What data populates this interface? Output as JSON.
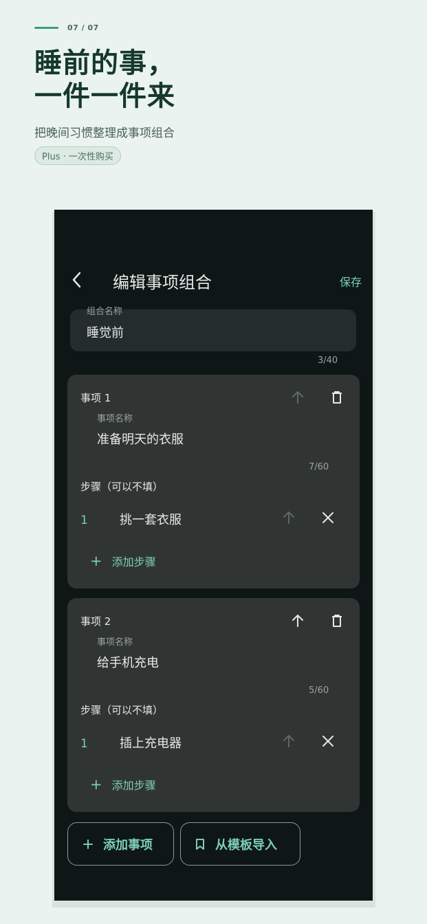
{
  "promo": {
    "page_counter": "07 / 07",
    "headline_line1": "睡前的事，",
    "headline_line2": "一件一件来",
    "subhead": "把晚间习惯整理成事项组合",
    "badge": "Plus · 一次性购买"
  },
  "colors": {
    "accent": "#7ccdb8",
    "screen_bg": "#0e1716",
    "card_bg": "#303534",
    "headline": "#16382d"
  },
  "appbar": {
    "back_icon": "chevron-left-icon",
    "title": "编辑事项组合",
    "save_label": "保存"
  },
  "group_name": {
    "label": "组合名称",
    "value": "睡觉前",
    "counter": "3/40"
  },
  "items": [
    {
      "title": "事项 1",
      "name_label": "事项名称",
      "name_value": "准备明天的衣服",
      "counter": "7/60",
      "steps_label": "步骤（可以不填）",
      "steps": [
        {
          "number": "1",
          "text": "挑一套衣服"
        }
      ],
      "add_step_label": "添加步骤",
      "move_up_enabled": false
    },
    {
      "title": "事项 2",
      "name_label": "事项名称",
      "name_value": "给手机充电",
      "counter": "5/60",
      "steps_label": "步骤（可以不填）",
      "steps": [
        {
          "number": "1",
          "text": "插上充电器"
        }
      ],
      "add_step_label": "添加步骤",
      "move_up_enabled": true
    }
  ],
  "bottom_actions": {
    "add_item_label": "添加事项",
    "import_label": "从模板导入"
  }
}
